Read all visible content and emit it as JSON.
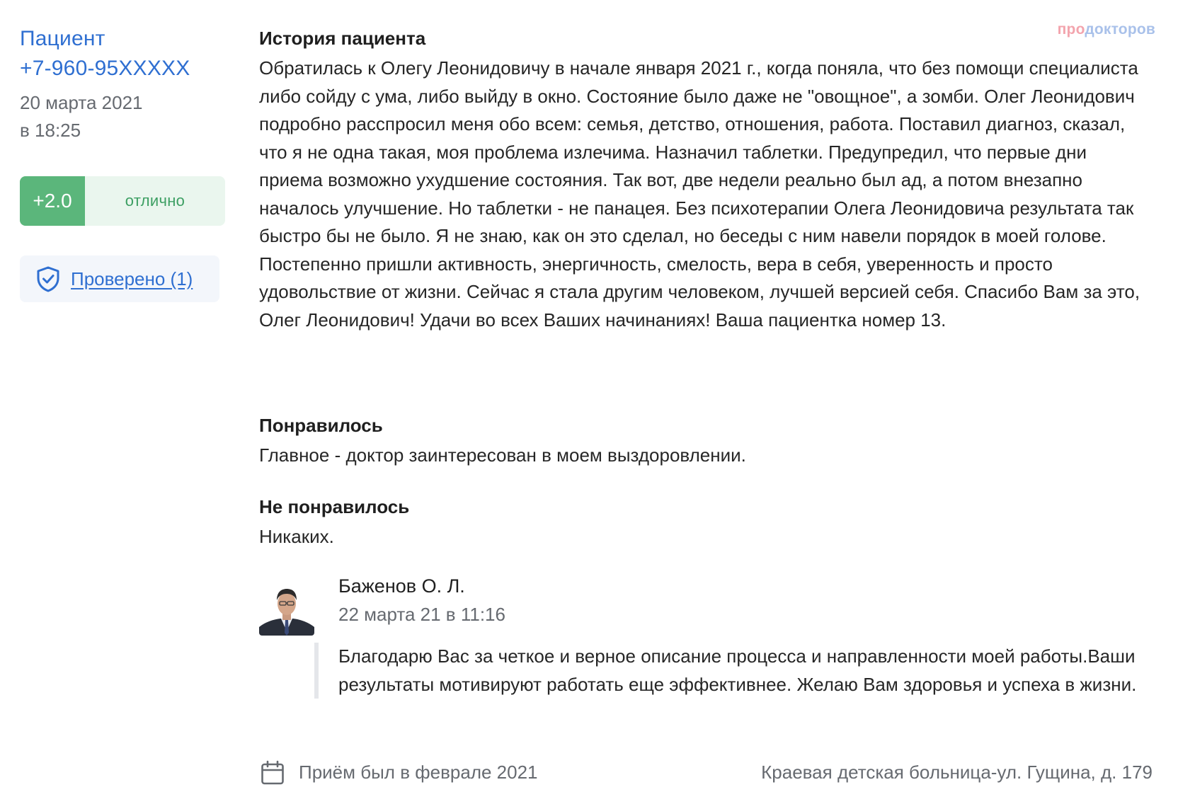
{
  "brand": {
    "part1": "про",
    "part2": "докторов"
  },
  "review": {
    "author": {
      "name": "Пациент",
      "phone": "+7-960-95XXXXX"
    },
    "date": "20 марта 2021",
    "time": "в 18:25",
    "rating": {
      "score": "+2.0",
      "label": "отлично"
    },
    "verified_label": "Проверено (1)",
    "history": {
      "title": "История пациента",
      "text": "Обратилась к Олегу Леонидовичу в начале января 2021 г., когда поняла, что без помощи специалиста либо сойду с ума, либо выйду в окно. Состояние было даже не \"овощное\", а зомби. Олег Леонидович подробно расспросил меня обо всем: семья, детство, отношения, работа. Поставил диагноз, сказал, что я не одна такая, моя проблема излечима. Назначил таблетки. Предупредил, что первые дни приема возможно ухудшение состояния. Так вот, две недели реально был ад, а потом внезапно началось улучшение. Но таблетки - не панацея. Без психотерапии Олега Леонидовича результата так быстро бы не было. Я не знаю, как он это сделал, но беседы с ним навели порядок в моей голове. Постепенно пришли активность, энергичность, смелость, вера в себя, уверенность и просто удовольствие от жизни. Сейчас я стала другим человеком, лучшей версией себя. Спасибо Вам за это, Олег Леонидович! Удачи во всех Ваших начинаниях! Ваша пациентка номер 13."
    },
    "liked": {
      "title": "Понравилось",
      "text": "Главное - доктор заинтересован в моем выздоровлении."
    },
    "disliked": {
      "title": "Не понравилось",
      "text": "Никаких."
    }
  },
  "reply": {
    "doctor_name": "Баженов О. Л.",
    "date": "22 марта 21 в 11:16",
    "text": "Благодарю Вас за четкое и верное описание процесса и направленности моей работы.Ваши результаты мотивируют работать еще эффективнее. Желаю Вам здоровья и успеха в жизни."
  },
  "footer": {
    "visit": "Приём был в феврале 2021",
    "clinic": "Краевая детская больница-ул. Гущина, д. 179"
  },
  "icons": {
    "shield": "shield-check-icon",
    "calendar": "calendar-icon"
  },
  "colors": {
    "link": "#2f6fd1",
    "rating_score_bg": "#5bb67b",
    "rating_label_bg": "#eaf6ee",
    "rating_label_text": "#3d9f63",
    "muted_text": "#666a70",
    "brand_pink": "#f3a4ad",
    "brand_blue": "#a9c1ea"
  }
}
